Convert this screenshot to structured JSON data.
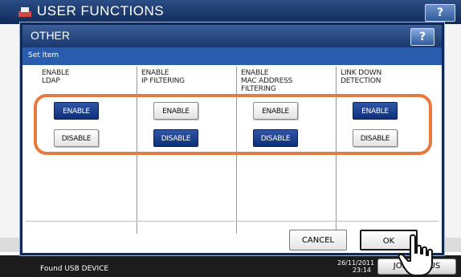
{
  "app": {
    "title": "USER FUNCTIONS",
    "help_label": "?",
    "status_text": "Found USB DEVICE",
    "status_date": "26/11/2011",
    "status_time": "23:14",
    "job_label": "JOB STATUS"
  },
  "dialog": {
    "title": "OTHER",
    "help_label": "?",
    "set_item_label": "Set Item",
    "columns": [
      {
        "label_lines": [
          "ENABLE",
          "LDAP"
        ],
        "enable_label": "ENABLE",
        "disable_label": "DISABLE",
        "selected": "ENABLE"
      },
      {
        "label_lines": [
          "ENABLE",
          "IP FILTERING"
        ],
        "enable_label": "ENABLE",
        "disable_label": "DISABLE",
        "selected": "DISABLE"
      },
      {
        "label_lines": [
          "ENABLE",
          "MAC ADDRESS",
          "FILTERING"
        ],
        "enable_label": "ENABLE",
        "disable_label": "DISABLE",
        "selected": "DISABLE"
      },
      {
        "label_lines": [
          "LINK DOWN",
          "DETECTION"
        ],
        "enable_label": "ENABLE",
        "disable_label": "DISABLE",
        "selected": "ENABLE"
      }
    ],
    "cancel_label": "CANCEL",
    "ok_label": "OK"
  },
  "colors": {
    "header_blue": "#1a386e",
    "set_item_blue": "#2a5cae",
    "highlight_orange": "#e77a3f",
    "selected_blue": "#0f2f7a"
  }
}
